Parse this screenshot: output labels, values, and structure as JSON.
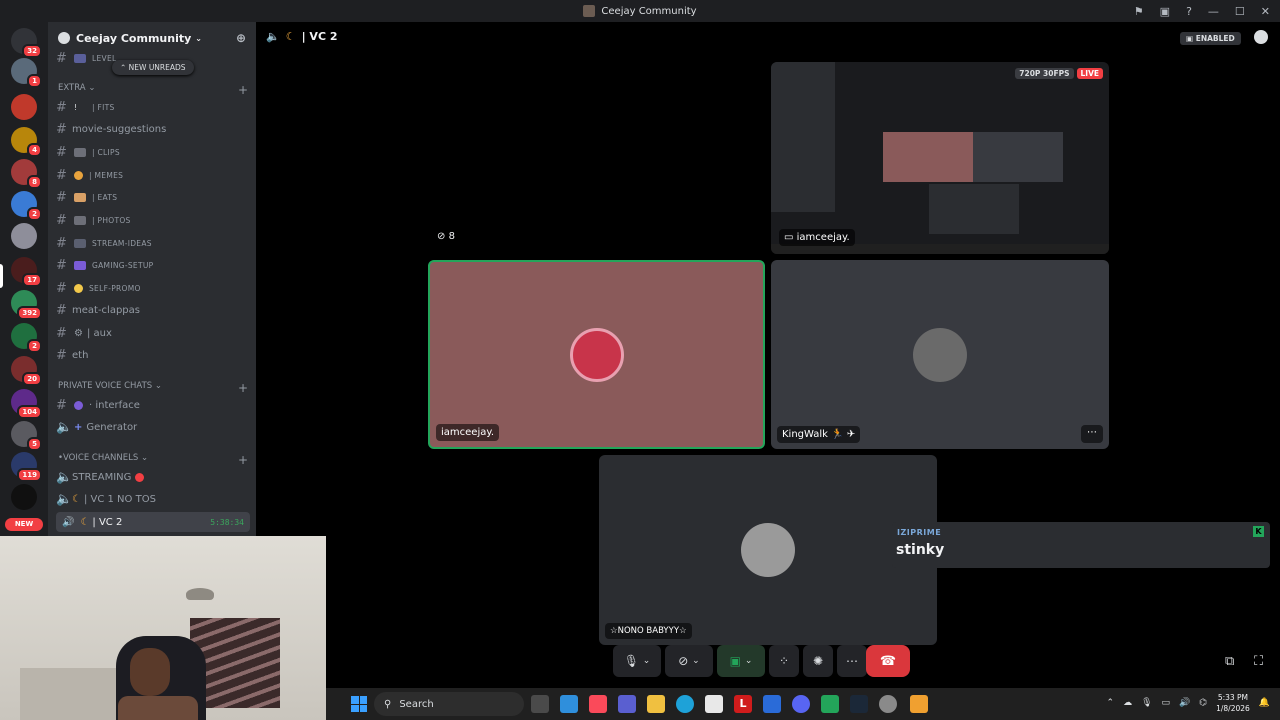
{
  "window": {
    "title": "Ceejay Community"
  },
  "server": {
    "name": "Ceejay Community",
    "chevron": "chevron-down-icon"
  },
  "guilds": [
    {
      "badge": "32"
    },
    {
      "badge": "1"
    },
    {
      "badge": ""
    },
    {
      "badge": "4"
    },
    {
      "badge": "8"
    },
    {
      "badge": "2"
    },
    {
      "badge": ""
    },
    {
      "badge": "17"
    },
    {
      "badge": "392"
    },
    {
      "badge": "2"
    },
    {
      "badge": "20"
    },
    {
      "badge": "104"
    },
    {
      "badge": "5"
    },
    {
      "badge": "119"
    },
    {
      "badge": ""
    },
    {
      "badge": "NEW"
    }
  ],
  "new_unreads": "NEW UNREADS",
  "partial_channel": "LEVEL",
  "categories": {
    "extra": "EXTRA",
    "private_voice": "PRIVATE VOICE CHATS",
    "voice": "VOICE CHANNELS"
  },
  "channels": [
    {
      "label": "| FITS"
    },
    {
      "label": "movie-suggestions"
    },
    {
      "label": "| CLIPS"
    },
    {
      "label": "| MEMES"
    },
    {
      "label": "| EATS"
    },
    {
      "label": "| PHOTOS"
    },
    {
      "label": "STREAM-IDEAS"
    },
    {
      "label": "GAMING-SETUP"
    },
    {
      "label": "SELF-PROMO"
    },
    {
      "label": "meat-clappas"
    },
    {
      "label": "| aux"
    },
    {
      "label": "eth"
    }
  ],
  "private_channels": [
    {
      "label": "· interface"
    },
    {
      "label": "Generator"
    }
  ],
  "voice_channels": [
    {
      "label": "STREAMING"
    },
    {
      "label": "| VC 1 NO TOS"
    },
    {
      "label": "| VC 2",
      "timer": "5:38:34"
    }
  ],
  "vc_header": {
    "title": "| VC 2",
    "enabled": "ENABLED"
  },
  "stream": {
    "quality": "720P 30FPS",
    "live": "LIVE",
    "name": "iamceejay.",
    "viewers": "8"
  },
  "participants": [
    {
      "name": "iamceejay.",
      "bg": "#8a5a5a",
      "speaking": true
    },
    {
      "name": "KingWalk",
      "bg": "#383a40",
      "speaking": false
    },
    {
      "name": "☆NONO BABYYY☆",
      "bg": "#2b2d31",
      "speaking": false
    }
  ],
  "notification": {
    "user": "IZIPRIME",
    "message": "stinky"
  },
  "taskbar": {
    "search_placeholder": "Search",
    "time": "5:33 PM",
    "date": "1/8/2026"
  },
  "colors": {
    "accent": "#5865f2",
    "speaking": "#23a55a",
    "hangup": "#da373c"
  }
}
